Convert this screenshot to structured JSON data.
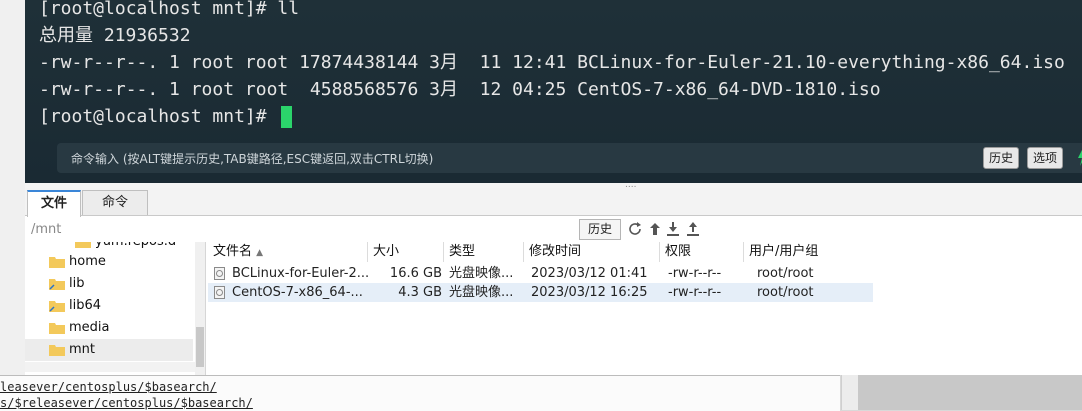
{
  "terminal": {
    "lines": [
      "[root@localhost mnt]# ll",
      "总用量 21936532",
      "-rw-r--r--. 1 root root 17874438144 3月  11 12:41 BCLinux-for-Euler-21.10-everything-x86_64.iso",
      "-rw-r--r--. 1 root root  4588568576 3月  12 04:25 CentOS-7-x86_64-DVD-1810.iso",
      "[root@localhost mnt]# "
    ],
    "command_bar": {
      "placeholder": "命令输入 (按ALT键提示历史,TAB键路径,ESC键返回,双击CTRL切换)",
      "history_label": "历史",
      "options_label": "选项"
    }
  },
  "colors": {
    "cursor": "#2bd46b",
    "accent": "#3a86d8",
    "terminal_bg": "#1b2b34"
  },
  "tabs": [
    {
      "label": "文件",
      "active": true
    },
    {
      "label": "命令",
      "active": false
    }
  ],
  "pathbar": {
    "path": "/mnt",
    "history_label": "历史",
    "icons": [
      "refresh-icon",
      "up-dir-icon",
      "download-icon",
      "upload-icon"
    ]
  },
  "tree": {
    "items": [
      {
        "label": "yum.repos.d"
      },
      {
        "label": "home"
      },
      {
        "label": "lib"
      },
      {
        "label": "lib64"
      },
      {
        "label": "media"
      },
      {
        "label": "mnt",
        "selected": true
      }
    ]
  },
  "file_list": {
    "columns": [
      "文件名",
      "大小",
      "类型",
      "修改时间",
      "权限",
      "用户/用户组"
    ],
    "rows": [
      {
        "name": "BCLinux-for-Euler-2...",
        "size": "16.6 GB",
        "type": "光盘映像...",
        "mtime": "2023/03/12 01:41",
        "perm": "-rw-r--r--",
        "owner": "root/root"
      },
      {
        "name": "CentOS-7-x86_64-...",
        "size": "4.3 GB",
        "type": "光盘映像...",
        "mtime": "2023/03/12 16:25",
        "perm": "-rw-r--r--",
        "owner": "root/root"
      }
    ]
  },
  "editor": {
    "lines": [
      "leasever/centosplus/$basearch/",
      "s/$releasever/centosplus/$basearch/"
    ]
  }
}
